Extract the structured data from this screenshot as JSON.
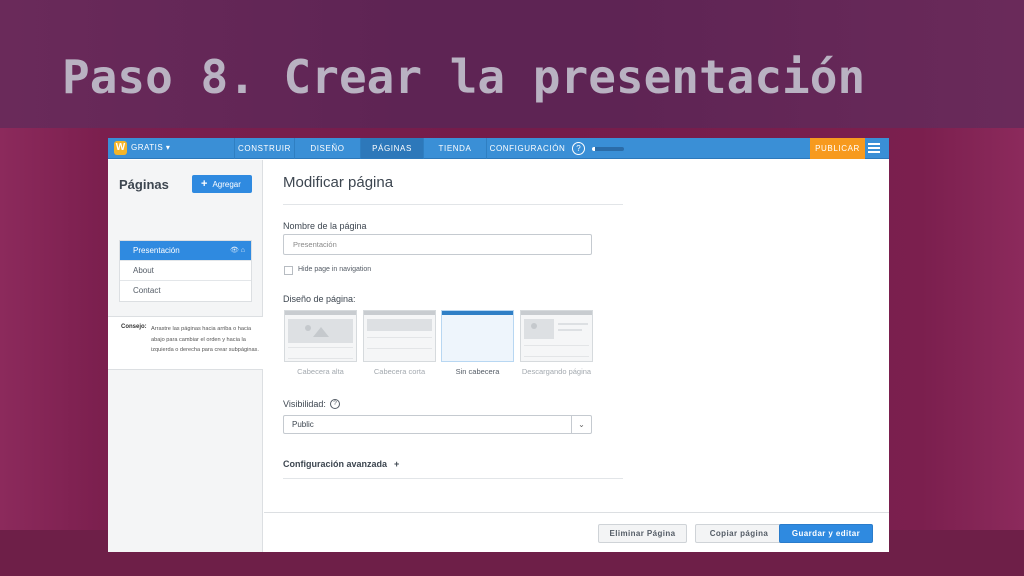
{
  "slide": {
    "title": "Paso 8. Crear la presentación"
  },
  "topbar": {
    "logo": "W",
    "plan": "GRATIS ▾",
    "nav": [
      "CONSTRUIR",
      "DISEÑO",
      "PÁGINAS",
      "TIENDA",
      "CONFIGURACIÓN"
    ],
    "active_nav": "PÁGINAS",
    "help": "?",
    "progress": 0.1,
    "publish": "PUBLICAR",
    "colors": {
      "bar": "#3a8fd6",
      "publish": "#f79a1e"
    }
  },
  "sidebar": {
    "title": "Páginas",
    "add_label": "Agregar",
    "pages": [
      "Presentación",
      "About",
      "Contact"
    ],
    "selected_page": "Presentación",
    "tip_label": "Consejo:",
    "tip_text": "Arrastre las páginas hacia arriba o hacia abajo para cambiar el orden y hacia la izquierda o derecha para crear subpáginas."
  },
  "form": {
    "heading": "Modificar página",
    "name_label": "Nombre de la página",
    "name_value": "Presentación",
    "hide_label": "Hide page in navigation",
    "hide_checked": false,
    "layout_label": "Diseño de página:",
    "layouts": [
      "Cabecera alta",
      "Cabecera corta",
      "Sin cabecera",
      "Descargando página"
    ],
    "selected_layout": "Sin cabecera",
    "visibility_label": "Visibilidad:",
    "visibility_value": "Public",
    "advanced_label": "Configuración avanzada",
    "advanced_plus": "+"
  },
  "footer": {
    "delete": "Eliminar Página",
    "copy": "Copiar página",
    "save": "Guardar y editar"
  }
}
